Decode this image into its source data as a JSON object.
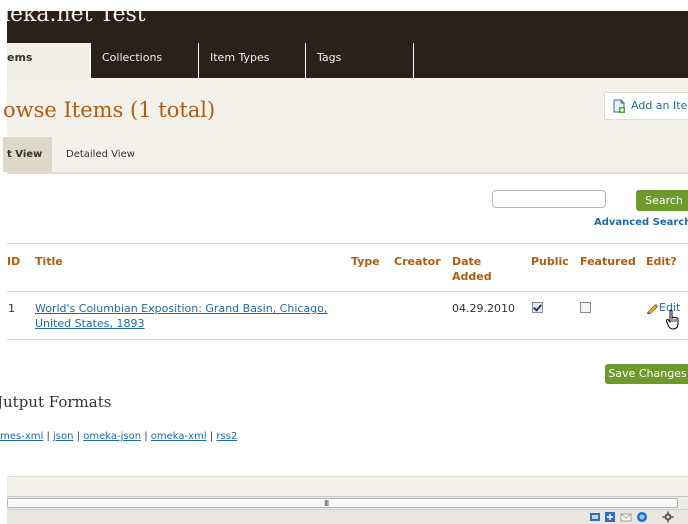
{
  "header": {
    "site_title": "ieka.net Test"
  },
  "nav": {
    "tabs": [
      "ems",
      "Collections",
      "Item Types",
      "Tags"
    ]
  },
  "page": {
    "title": "owse Items (1 total)",
    "add_button": "Add an Ite",
    "view_tabs": [
      "t View",
      "Detailed View"
    ]
  },
  "search": {
    "placeholder": "",
    "button": "Search",
    "advanced_link": "Advanced Search"
  },
  "table": {
    "headers": {
      "id": "ID",
      "title": "Title",
      "type": "Type",
      "creator": "Creator",
      "date_added": "Date Added",
      "public": "Public",
      "featured": "Featured",
      "edit": "Edit?"
    },
    "rows": [
      {
        "id": "1",
        "title": "World's Columbian Exposition: Grand Basin, Chicago, United States, 1893",
        "type": "",
        "creator": "",
        "date_added": "04.29.2010",
        "public": true,
        "featured": false,
        "edit": "Edit"
      }
    ]
  },
  "actions": {
    "save_button": "Save Changes"
  },
  "output": {
    "title": "Jutput Formats",
    "formats": [
      "omes-xml",
      "json",
      "omeka-json",
      "omeka-xml",
      "rss2"
    ],
    "separator": "|"
  },
  "scrollbar": {
    "grip": "III"
  },
  "colors": {
    "header_bg": "#2b211b",
    "accent_orange": "#b05c12",
    "link_blue": "#1e6aa8",
    "button_green": "#6c9a2c",
    "band_bg": "#f3f1ea"
  },
  "icons": [
    "add-item-icon",
    "pencil-icon",
    "hand-cursor-icon",
    "checkbox-checked-icon",
    "checkbox-unchecked-icon"
  ]
}
